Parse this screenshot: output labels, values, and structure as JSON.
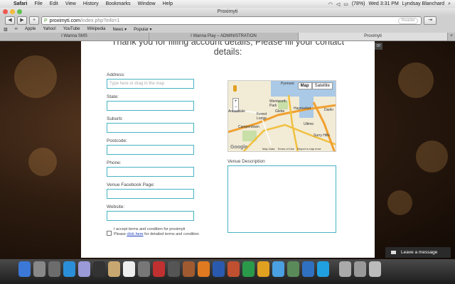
{
  "menubar": {
    "app": "Safari",
    "items": [
      "File",
      "Edit",
      "View",
      "History",
      "Bookmarks",
      "Window",
      "Help"
    ],
    "battery": "(78%)",
    "clock": "Wed 3:31 PM",
    "user": "Lyndsay Blanchard"
  },
  "window": {
    "title": "Proximyti"
  },
  "toolbar": {
    "back": "◀",
    "forward": "▶",
    "add": "+",
    "url_domain": "proximyti.com",
    "url_path": "/index.php?info=1",
    "reader": "Reader"
  },
  "bookmarks": {
    "items": [
      "Apple",
      "Yahoo!",
      "YouTube",
      "Wikipedia",
      "News ▾",
      "Popular ▾"
    ]
  },
  "tabs": [
    {
      "label": "I Wanna SMS"
    },
    {
      "label": "I Wanna Play – ADMINISTRATION"
    },
    {
      "label": "Proximyti"
    }
  ],
  "modal": {
    "heading_line1": "Thank you for filling account details, Please fill your contact",
    "heading_line2": "details:",
    "close": "or",
    "fields": {
      "address": {
        "label": "Address:",
        "placeholder": "Type here or drag in the map"
      },
      "state": {
        "label": "State:"
      },
      "suburb": {
        "label": "Suburb:"
      },
      "postcode": {
        "label": "Postcode:"
      },
      "phone": {
        "label": "Phone:"
      },
      "facebook": {
        "label": "Venue Facebook Page:"
      },
      "website": {
        "label": "Website:"
      }
    },
    "map": {
      "toggle_map": "Map",
      "toggle_satellite": "Satellite",
      "labels": [
        "Pyrmont",
        "Wentworth Park",
        "Forest Lodge",
        "Glebe",
        "Haymarket",
        "Darlin",
        "Annandale",
        "Camperdown",
        "Ultimo",
        "Surry Hills"
      ],
      "google": "Google",
      "footer_links": [
        "Map Data",
        "Terms of Use",
        "Report a map error"
      ]
    },
    "venue_description": {
      "label": "Venue Description"
    },
    "terms": {
      "line1": "I accept terms and condition for proximyti",
      "line2_pre": "Please ",
      "link": "click here",
      "line2_post": " for detailed terms and condition"
    }
  },
  "chat": {
    "label": "Leave a message"
  },
  "colors": {
    "input_border": "#47b3c4",
    "link": "#1a3dbb"
  }
}
